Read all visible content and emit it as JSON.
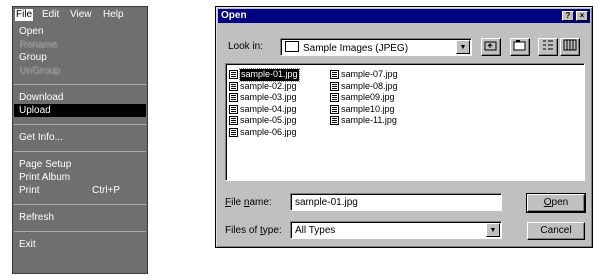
{
  "menu": {
    "menubar": [
      "File",
      "Edit",
      "View",
      "Help"
    ],
    "groups": [
      [
        {
          "label": "Open",
          "disabled": false,
          "selected": false,
          "shortcut": ""
        },
        {
          "label": "Rename",
          "disabled": true,
          "selected": false,
          "shortcut": ""
        },
        {
          "label": "Group",
          "disabled": false,
          "selected": false,
          "shortcut": ""
        },
        {
          "label": "UnGroup",
          "disabled": true,
          "selected": false,
          "shortcut": ""
        }
      ],
      [
        {
          "label": "Download",
          "disabled": false,
          "selected": false,
          "shortcut": ""
        },
        {
          "label": "Upload",
          "disabled": false,
          "selected": true,
          "shortcut": ""
        }
      ],
      [
        {
          "label": "Get Info...",
          "disabled": false,
          "selected": false,
          "shortcut": ""
        }
      ],
      [
        {
          "label": "Page Setup",
          "disabled": false,
          "selected": false,
          "shortcut": ""
        },
        {
          "label": "Print Album",
          "disabled": false,
          "selected": false,
          "shortcut": ""
        },
        {
          "label": "Print",
          "disabled": false,
          "selected": false,
          "shortcut": "Ctrl+P"
        }
      ],
      [
        {
          "label": "Refresh",
          "disabled": false,
          "selected": false,
          "shortcut": ""
        }
      ],
      [
        {
          "label": "Exit",
          "disabled": false,
          "selected": false,
          "shortcut": ""
        }
      ]
    ]
  },
  "dialog": {
    "title": "Open",
    "help_button": "?",
    "close_button": "×",
    "look_in_label": "Look in:",
    "look_in_value": "Sample Images (JPEG)",
    "tool_icons": [
      "up-one-level-icon",
      "new-folder-icon",
      "list-view-icon",
      "details-view-icon"
    ],
    "files": [
      "sample-01.jpg",
      "sample-02.jpg",
      "sample-03.jpg",
      "sample-04.jpg",
      "sample-05.jpg",
      "sample-06.jpg",
      "sample-07.jpg",
      "sample-08.jpg",
      "sample09.jpg",
      "sample10.jpg",
      "sample-11.jpg"
    ],
    "selected_file": "sample-01.jpg",
    "file_name_label": "File name:",
    "file_name_value": "sample-01.jpg",
    "files_of_type_label": "Files of type:",
    "files_of_type_value": "All Types",
    "open_button": "Open",
    "cancel_button": "Cancel"
  }
}
